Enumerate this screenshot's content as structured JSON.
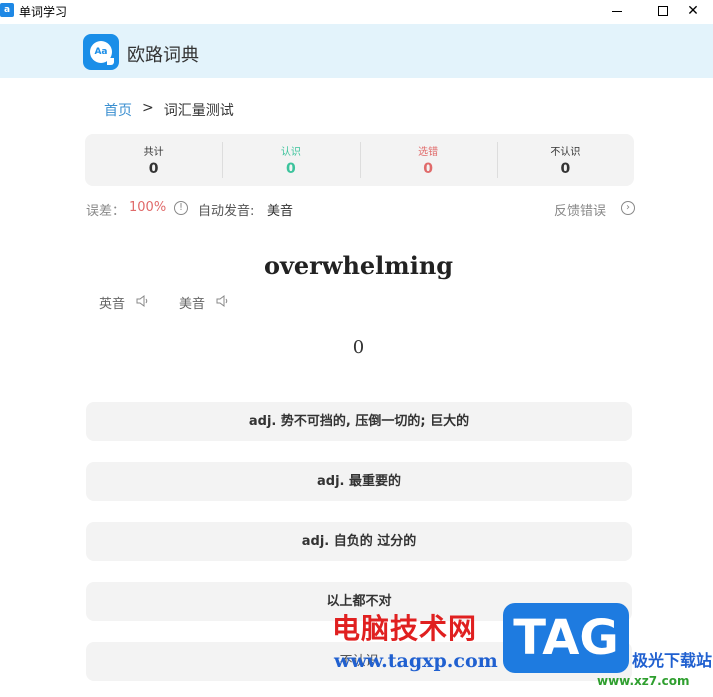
{
  "window": {
    "title": "单词学习",
    "app_icon_text": "a"
  },
  "header": {
    "app_name": "欧路词典",
    "logo_text": "Aa"
  },
  "breadcrumb": {
    "home": "首页",
    "separator": ">",
    "current": "词汇量测试"
  },
  "stats": {
    "total": {
      "label": "共计",
      "value": "0"
    },
    "known": {
      "label": "认识",
      "value": "0"
    },
    "wrong": {
      "label": "选错",
      "value": "0"
    },
    "unknown": {
      "label": "不认识",
      "value": "0"
    }
  },
  "info": {
    "error_label": "误差：",
    "error_value": "100%",
    "auto_label": "自动发音:",
    "auto_value": "美音",
    "feedback": "反馈错误"
  },
  "word": "overwhelming",
  "pronunciation": {
    "uk": "英音",
    "us": "美音"
  },
  "counter": "0",
  "options": [
    "adj. 势不可挡的, 压倒一切的; 巨大的",
    "adj. 最重要的",
    "adj. 自负的 过分的",
    "以上都不对",
    "不认识"
  ],
  "watermark": {
    "cn": "电脑技术网",
    "url": "www.tagxp.com",
    "tag": "TAG",
    "site": "极光下载站",
    "url2": "www.xz7.com"
  },
  "colors": {
    "accent": "#1a8ee8",
    "known": "#3cc39c",
    "wrong": "#e06a6a",
    "header_bg": "#e3f3fb"
  }
}
